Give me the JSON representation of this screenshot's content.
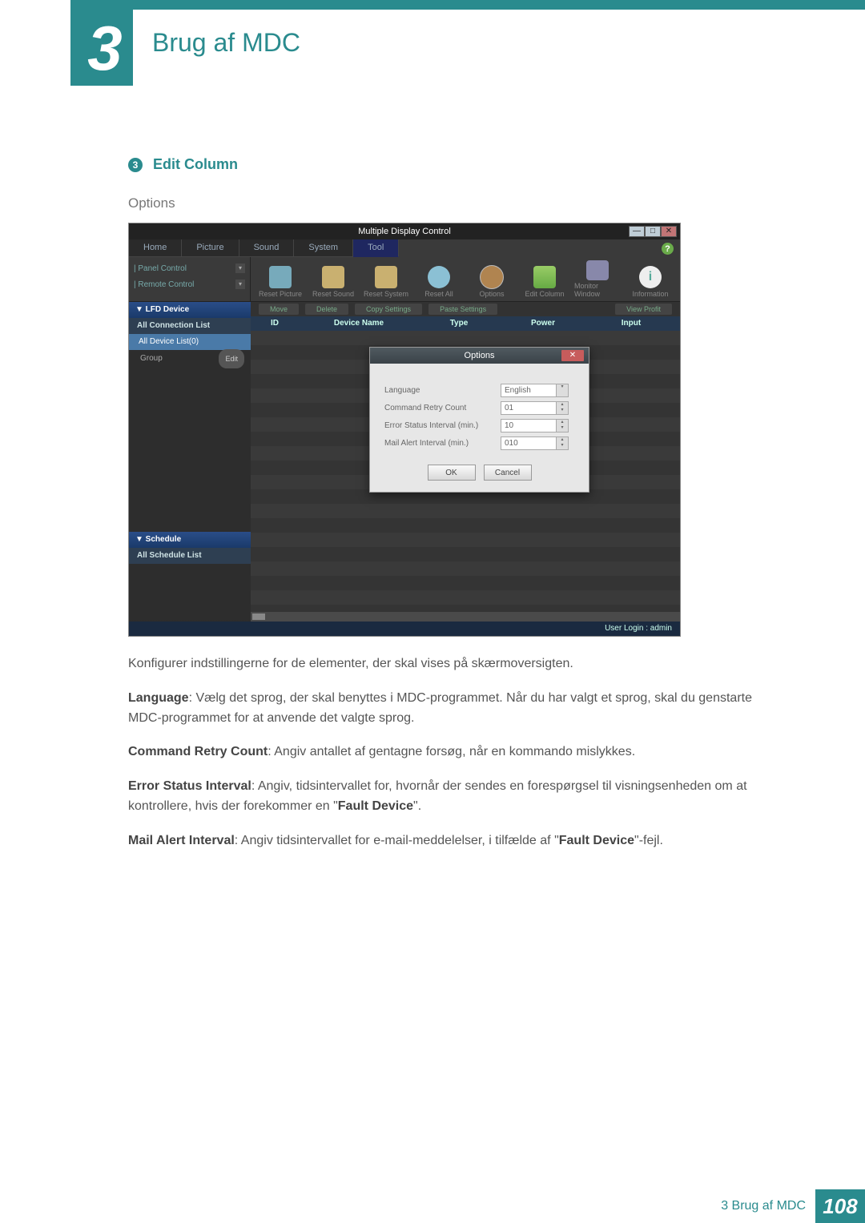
{
  "chapter": {
    "number": "3",
    "title": "Brug af MDC"
  },
  "section": {
    "bullet_number": "3",
    "heading": "Edit Column",
    "subheading": "Options"
  },
  "app": {
    "title": "Multiple Display Control",
    "tabs": [
      "Home",
      "Picture",
      "Sound",
      "System",
      "Tool"
    ],
    "left_controls": {
      "panel_control": "| Panel Control",
      "remote_control": "| Remote Control"
    },
    "ribbon": {
      "reset_picture": "Reset Picture",
      "reset_sound": "Reset Sound",
      "reset_system": "Reset System",
      "reset_all": "Reset All",
      "options": "Options",
      "edit_column": "Edit Column",
      "monitor_window": "Monitor Window",
      "information": "Information"
    },
    "toolbar": {
      "move": "Move",
      "delete": "Delete",
      "copy": "Copy Settings",
      "paste": "Paste Settings",
      "view": "View Profit"
    },
    "sidebar": {
      "lfd_header": "▼ LFD Device",
      "all_conn": "All Connection List",
      "all_device": "All Device List(0)",
      "group": "Group",
      "edit": "Edit",
      "schedule_header": "▼ Schedule",
      "all_schedule": "All Schedule List"
    },
    "columns": {
      "id": "ID",
      "device_name": "Device Name",
      "type": "Type",
      "power": "Power",
      "input": "Input"
    },
    "dialog": {
      "title": "Options",
      "rows": {
        "language": {
          "label": "Language",
          "value": "English"
        },
        "retry": {
          "label": "Command Retry Count",
          "value": "01"
        },
        "error_interval": {
          "label": "Error Status Interval (min.)",
          "value": "10"
        },
        "mail_interval": {
          "label": "Mail Alert Interval (min.)",
          "value": "010"
        }
      },
      "ok": "OK",
      "cancel": "Cancel"
    },
    "status": "User Login : admin"
  },
  "paragraphs": {
    "p1": "Konfigurer indstillingerne for de elementer, der skal vises på skærmoversigten.",
    "p2_bold": "Language",
    "p2_rest": ": Vælg det sprog, der skal benyttes i MDC-programmet. Når du har valgt et sprog, skal du genstarte MDC-programmet for at anvende det valgte sprog.",
    "p3_bold": "Command Retry Count",
    "p3_rest": ": Angiv antallet af gentagne forsøg, når en kommando mislykkes.",
    "p4_bold": "Error Status Interval",
    "p4_rest_a": ": Angiv, tidsintervallet for, hvornår der sendes en forespørgsel til visningsenheden om at kontrollere, hvis der forekommer en \"",
    "p4_rest_b": "Fault Device",
    "p4_rest_c": "\".",
    "p5_bold": "Mail Alert Interval",
    "p5_rest_a": ": Angiv tidsintervallet for e-mail-meddelelser, i tilfælde af \"",
    "p5_rest_b": "Fault Device",
    "p5_rest_c": "\"-fejl."
  },
  "footer": {
    "text": "3 Brug af MDC",
    "page": "108"
  }
}
